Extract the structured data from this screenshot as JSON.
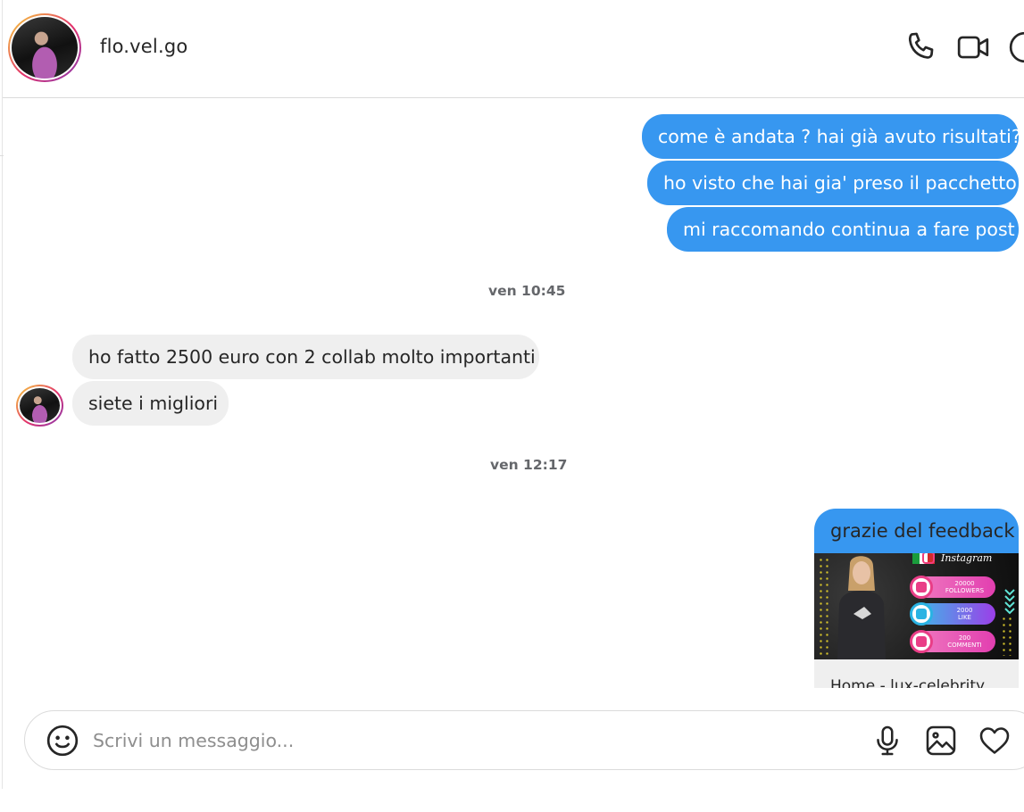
{
  "header": {
    "username": "flo.vel.go",
    "icons": [
      "phone-icon",
      "video-camera-icon",
      "info-icon"
    ]
  },
  "messages": {
    "outgoing_1": "come è andata ? hai già avuto risultati?",
    "outgoing_2": "ho visto che hai gia' preso il pacchetto",
    "outgoing_3": "mi raccomando continua a fare post",
    "timestamp_1": "ven 10:45",
    "incoming_1": "ho fatto 2500 euro con 2 collab molto importanti",
    "incoming_2": "siete i migliori",
    "timestamp_2": "ven 12:17",
    "outgoing_4": "grazie del feedback"
  },
  "shared_post": {
    "brand": "Instagram",
    "stats": [
      {
        "value": "20000",
        "label": "FOLLOWERS"
      },
      {
        "value": "2000",
        "label": "LIKE"
      },
      {
        "value": "200",
        "label": "COMMENTI"
      }
    ],
    "link_text": "Home - lux-celebrity"
  },
  "composer": {
    "placeholder": "Scrivi un messaggio...",
    "icons": [
      "emoji-icon",
      "microphone-icon",
      "image-icon",
      "heart-icon"
    ]
  },
  "colors": {
    "outgoing_bubble": "#3797f0",
    "incoming_bubble": "#efefef",
    "text": "#262626",
    "timestamp": "#65676b"
  }
}
